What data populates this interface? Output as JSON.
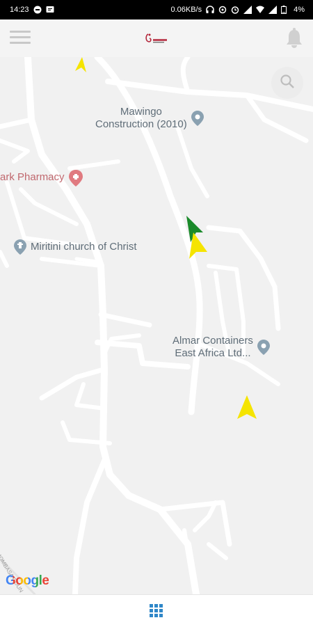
{
  "status_bar": {
    "time": "14:23",
    "network_speed": "0.06KB/s",
    "battery": "4%"
  },
  "app_bar": {
    "menu_icon": "hamburger-menu-icon",
    "logo_icon": "app-logo-icon",
    "notification_icon": "bell-icon"
  },
  "map": {
    "places": [
      {
        "label": "Mawingo\nConstruction (2010)",
        "icon": "place-pin-icon"
      },
      {
        "label": "ark Pharmacy",
        "icon": "pharmacy-pin-icon"
      },
      {
        "label": "Miritini church of Christ",
        "icon": "church-pin-icon"
      },
      {
        "label": "Almar Containers\nEast Africa Ltd...",
        "icon": "place-pin-icon"
      }
    ],
    "street_label": "MOMBASA COUN",
    "attribution": "Google",
    "search_icon": "search-icon",
    "vehicle_markers": [
      {
        "color": "#f5e400",
        "heading": "north"
      },
      {
        "color": "#f5e400",
        "heading": "north"
      },
      {
        "color": "#f5e400",
        "heading": "north"
      },
      {
        "color": "#1a8a2a",
        "heading": "north-west"
      }
    ]
  },
  "bottom_bar": {
    "apps_icon": "apps-grid-icon"
  },
  "colors": {
    "map_background": "#f1f1f1",
    "road": "#ffffff",
    "poi_text": "#5f6d78",
    "pharmacy": "#c0686e",
    "accent": "#2f87c8"
  }
}
